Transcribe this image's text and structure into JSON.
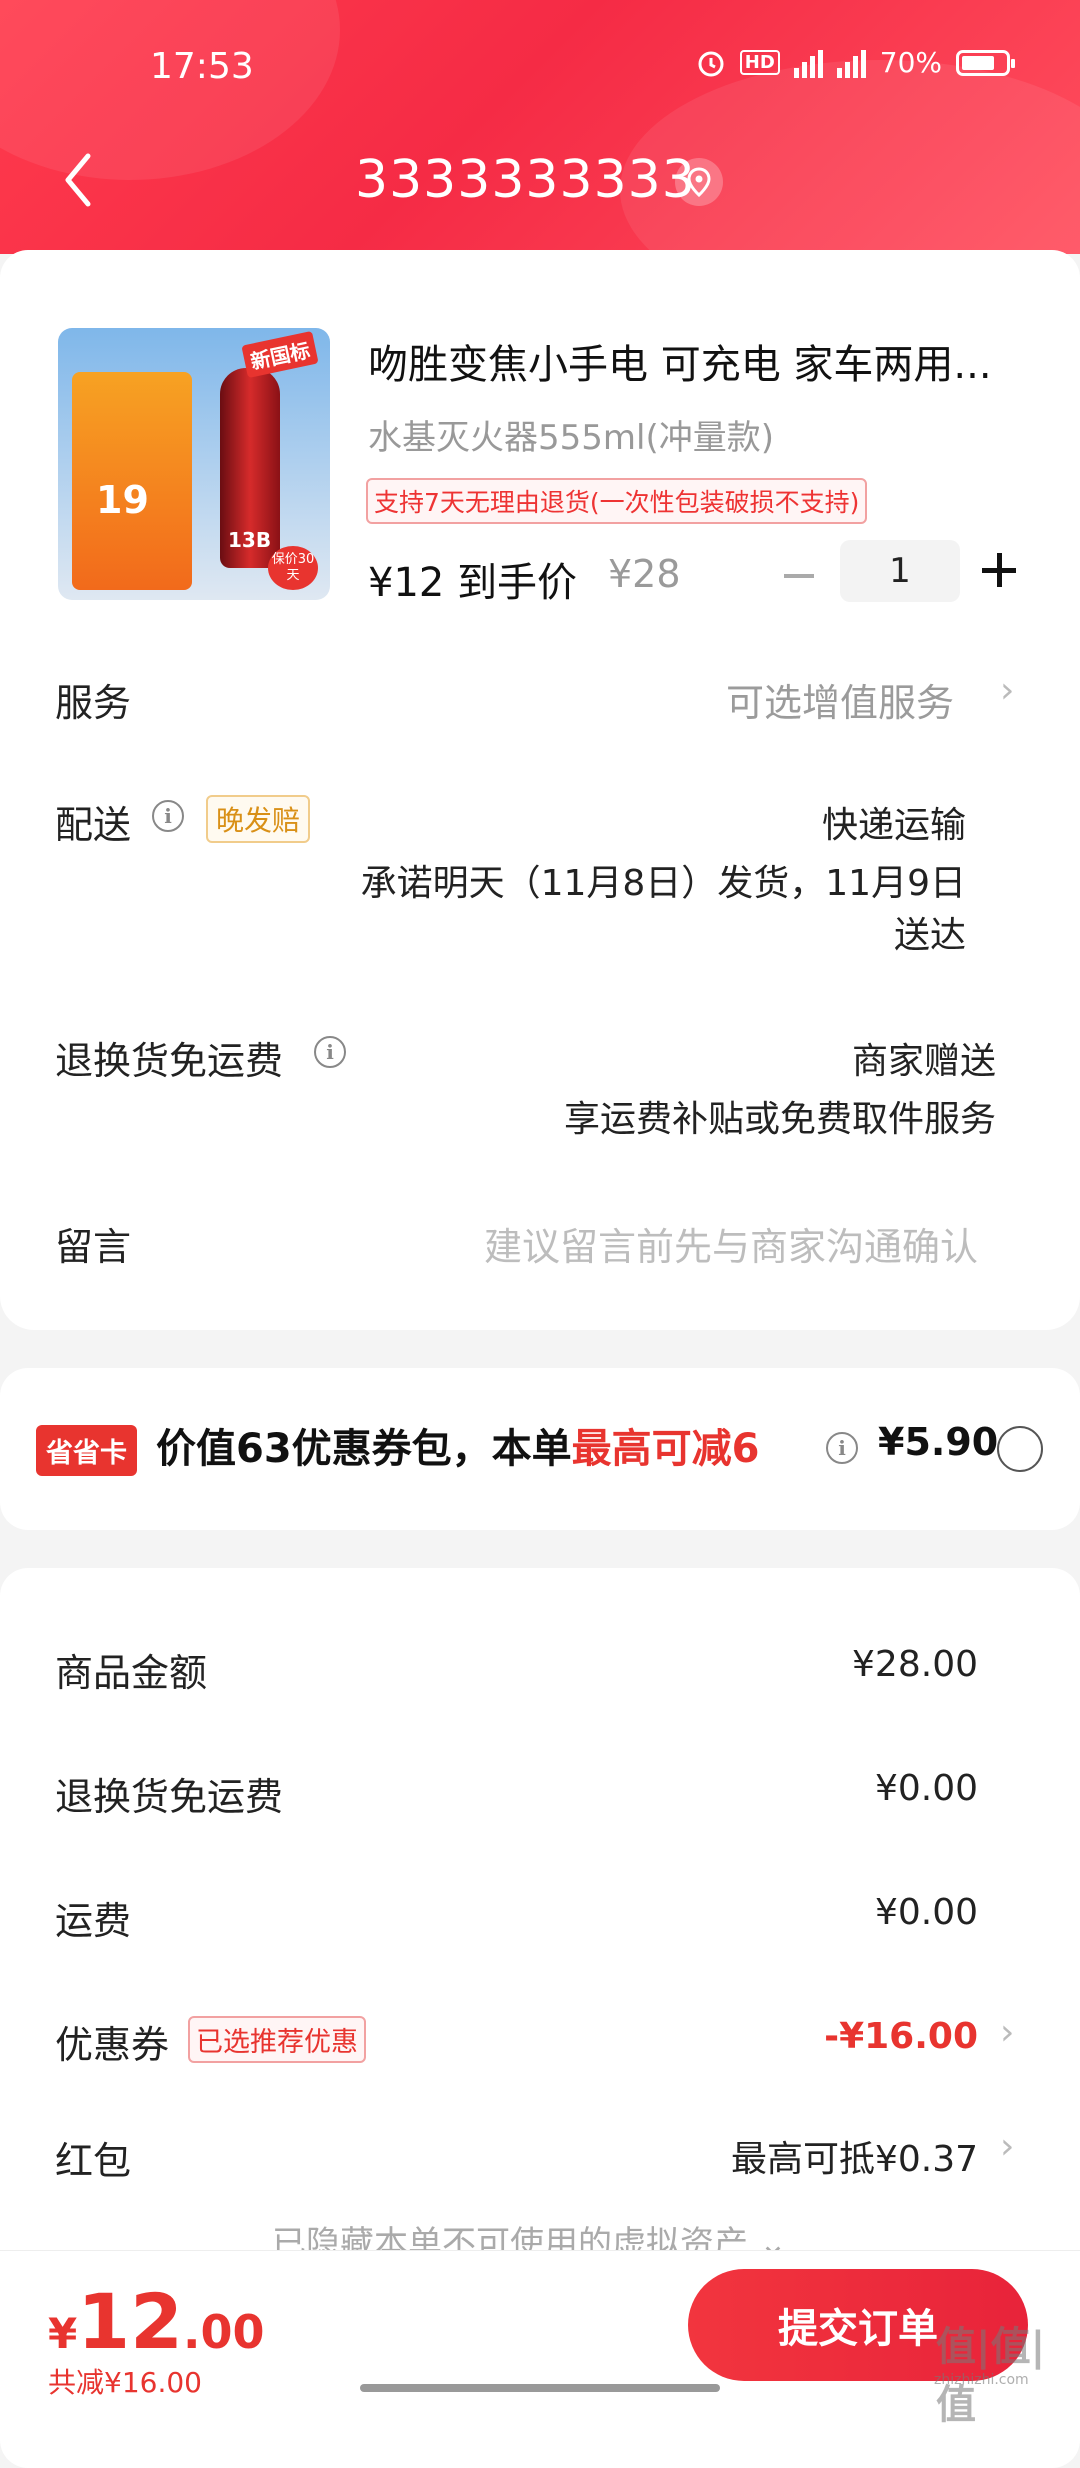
{
  "status_bar": {
    "time": "17:53",
    "battery": "70%"
  },
  "header": {
    "title": "3333333333"
  },
  "product": {
    "title": "吻胜变焦小手电 可充电 家车两用...",
    "spec": "水基灭火器555ml(冲量款)",
    "return_badge": "支持7天无理由退货(一次性包装破损不支持)",
    "price_now": "¥12 到手价",
    "price_old": "¥28",
    "quantity": "1",
    "image": {
      "badge_top": "新国标",
      "cylinder_text": "13B",
      "poster_price": "19",
      "corner_badge": "保价30天"
    }
  },
  "rows": {
    "service": {
      "label": "服务",
      "value": "可选增值服务"
    },
    "delivery": {
      "label": "配送",
      "tag": "晚发赔",
      "method": "快递运输",
      "promise_line1": "承诺明天（11月8日）发货，11月9日",
      "promise_line2": "送达"
    },
    "return_shipping": {
      "label": "退换货免运费",
      "value_line1": "商家赠送",
      "value_line2": "享运费补贴或免费取件服务"
    },
    "message": {
      "label": "留言",
      "placeholder": "建议留言前先与商家沟通确认"
    }
  },
  "promo": {
    "tag": "省省卡",
    "text_a": "价值63优惠券包，本单",
    "text_b": "最高可减6",
    "price": "¥5.90"
  },
  "summary": {
    "goods": {
      "label": "商品金额",
      "value": "¥28.00"
    },
    "return_fee": {
      "label": "退换货免运费",
      "value": "¥0.00"
    },
    "shipping": {
      "label": "运费",
      "value": "¥0.00"
    },
    "coupon": {
      "label": "优惠券",
      "tag": "已选推荐优惠",
      "value": "-¥16.00"
    },
    "red_packet": {
      "label": "红包",
      "value": "最高可抵¥0.37"
    },
    "hidden_note": "已隐藏本单不可使用的虚拟资产"
  },
  "footer": {
    "yen": "¥",
    "total_int": "12",
    "total_dec": ".00",
    "saved": "共减¥16.00",
    "submit": "提交订单"
  },
  "watermark": {
    "main": "值|值|值",
    "sub": "zhizhizhi.com"
  },
  "colors": {
    "brand_red": "#e8342f",
    "header_red": "#f52b45"
  }
}
